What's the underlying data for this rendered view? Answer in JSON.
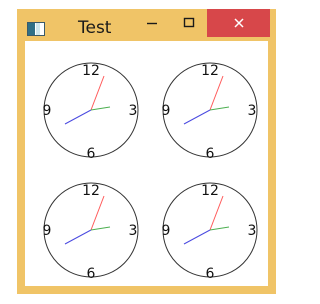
{
  "window": {
    "title": "Test",
    "app_icon": "window-app-icon",
    "buttons": {
      "minimize": "minimize-icon",
      "maximize": "maximize-icon",
      "close": "close-icon"
    },
    "colors": {
      "frame": "#f0c467",
      "close_button": "#d7474a",
      "client": "#ffffff"
    }
  },
  "clock": {
    "numerals": {
      "twelve": "12",
      "three": "3",
      "six": "6",
      "nine": "9"
    },
    "hand_colors": {
      "red": "#ff5a5a",
      "green": "#4caf50",
      "blue": "#4a4ae0"
    }
  }
}
